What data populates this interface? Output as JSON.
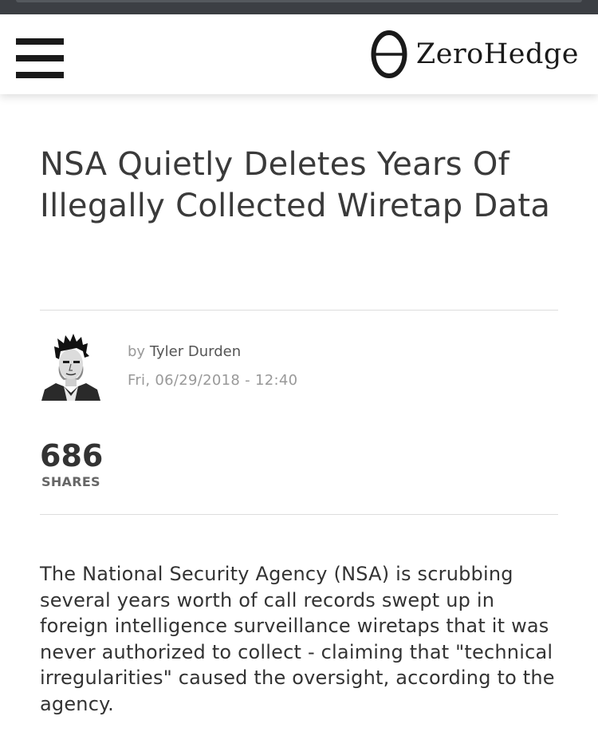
{
  "header": {
    "menu_icon": "hamburger-menu-icon",
    "logo_icon": "zerohedge-theta-logo",
    "logo_text": "ZeroHedge"
  },
  "article": {
    "title": "NSA Quietly Deletes Years Of Illegally Collected Wiretap Data",
    "by_label": "by",
    "author": "Tyler Durden",
    "date": "Fri, 06/29/2018 - 12:40",
    "share_count": "686",
    "share_label": "SHARES",
    "body": "The National Security Agency (NSA) is scrubbing several years worth of call records swept up in foreign intelligence surveillance wiretaps that it was never authorized to collect - claiming that \"technical irregularities\" caused the oversight, according to the agency."
  },
  "colors": {
    "top_strip": "#3c3f44",
    "text_dark": "#333333",
    "text_muted": "#999999",
    "divider": "#dddddd"
  }
}
